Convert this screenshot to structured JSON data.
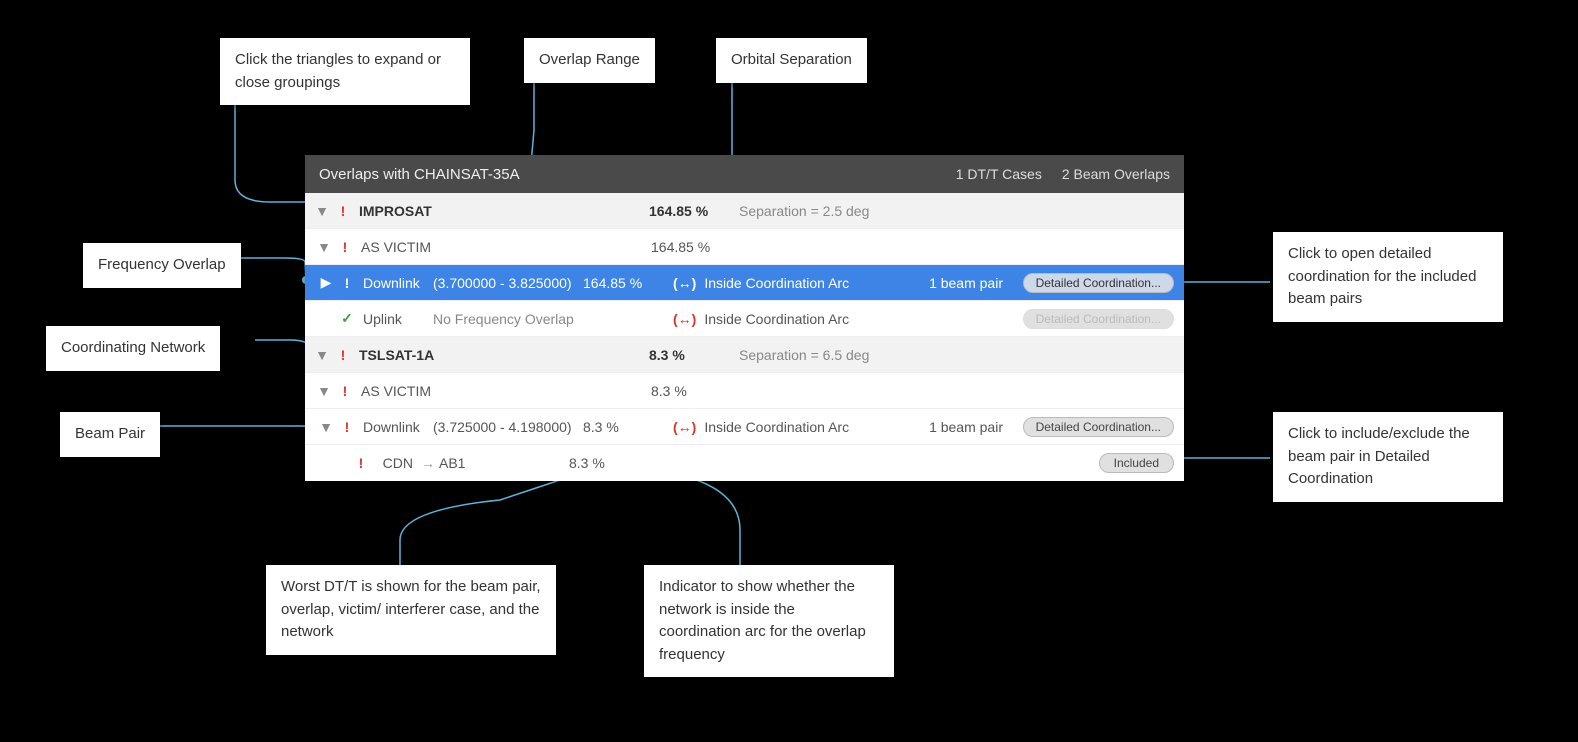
{
  "panel": {
    "title": "Overlaps with CHAINSAT-35A",
    "dtt_cases": "1 DT/T Cases",
    "beam_overlaps": "2 Beam Overlaps"
  },
  "networks": [
    {
      "name": "IMPROSAT",
      "pct": "164.85 %",
      "separation": "Separation = 2.5 deg",
      "victim": {
        "label": "AS VICTIM",
        "pct": "164.85 %"
      },
      "links": [
        {
          "selected": true,
          "status": "warn",
          "dir": "Downlink",
          "range": "(3.700000 - 3.825000)",
          "pct": "164.85 %",
          "arc": "Inside Coordination Arc",
          "beam_pairs": "1 beam pair",
          "btn": "Detailed Coordination..."
        },
        {
          "selected": false,
          "status": "ok",
          "dir": "Uplink",
          "range": "No Frequency Overlap",
          "pct": "",
          "arc": "Inside Coordination Arc",
          "beam_pairs": "",
          "btn": "Detailed Coordination...",
          "btn_disabled": true
        }
      ]
    },
    {
      "name": "TSLSAT-1A",
      "pct": "8.3 %",
      "separation": "Separation = 6.5 deg",
      "victim": {
        "label": "AS VICTIM",
        "pct": "8.3 %"
      },
      "links": [
        {
          "selected": false,
          "status": "warn",
          "dir": "Downlink",
          "range": "(3.725000 - 4.198000)",
          "pct": "8.3 %",
          "arc": "Inside Coordination Arc",
          "beam_pairs": "1 beam pair",
          "btn": "Detailed Coordination...",
          "children": [
            {
              "status": "warn",
              "from": "CDN",
              "to": "AB1",
              "pct": "8.3 %",
              "pill": "Included"
            }
          ]
        }
      ]
    }
  ],
  "callouts": {
    "triangles": "Click the triangles to expand or close groupings",
    "overlap_range": "Overlap Range",
    "orbital_sep": "Orbital Separation",
    "freq_overlap": "Frequency Overlap",
    "coord_network": "Coordinating Network",
    "beam_pair": "Beam Pair",
    "open_detailed": "Click to open detailed coordination for the included beam pairs",
    "include_exclude": "Click to include/exclude the beam pair in Detailed Coordination",
    "worst_dtt": "Worst DT/T is shown for the beam pair, overlap, victim/ interferer case, and the network",
    "arc_indicator": "Indicator to show whether the network is inside the coordination arc for the overlap frequency"
  }
}
